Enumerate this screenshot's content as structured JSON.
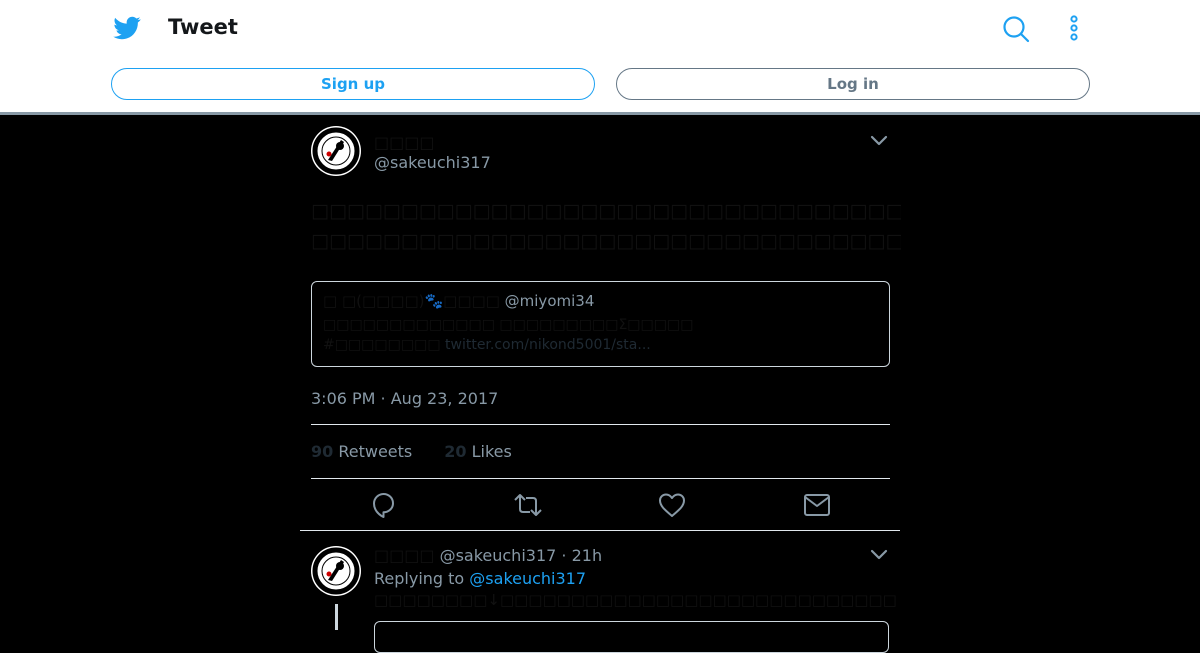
{
  "header": {
    "title": "Tweet",
    "brand_icon": "twitter-bird-icon",
    "search_icon": "search-icon",
    "more_icon": "more-vertical-icon",
    "signup_label": "Sign up",
    "login_label": "Log in"
  },
  "colors": {
    "brand": "#1da1f2",
    "muted": "#8899a6",
    "border": "#e1e8ed",
    "background": "#000000"
  },
  "tweet": {
    "display_name": "□□□□",
    "handle": "@sakeuchi317",
    "text_lines": [
      "□□□□□□□□□□□□□□□□□□□□□□□□□□□□□□□□□□□□□□□□□□□□□□□□",
      "□□□□□□□□□□□□□□□□□□□□□□□□□□□□□□□□□□□□□□□□□□□□□□"
    ],
    "quote": {
      "author": "□ □(□□□□)🐾□□□□",
      "handle": "@miyomi34",
      "line1": "□□□□□□□□□□□□□ □□□□□□□□□Σ□□□□□",
      "hashtag": "#□□□□□□□□",
      "link": "twitter.com/nikond5001/sta..."
    },
    "timestamp": "3:06 PM · Aug 23, 2017",
    "retweets_count": "90",
    "retweets_label": "Retweets",
    "likes_count": "20",
    "likes_label": "Likes",
    "actions": [
      "reply-icon",
      "retweet-icon",
      "like-icon",
      "message-icon"
    ]
  },
  "reply": {
    "display_name": "□□□□",
    "handle": "@sakeuchi317",
    "time": "· 21h",
    "replying_prefix": "Replying to",
    "replying_to": "@sakeuchi317",
    "text": "□□□□□□□□↓□□□□□□□□□□□□□□□□□□□□□□□□□□□□"
  }
}
